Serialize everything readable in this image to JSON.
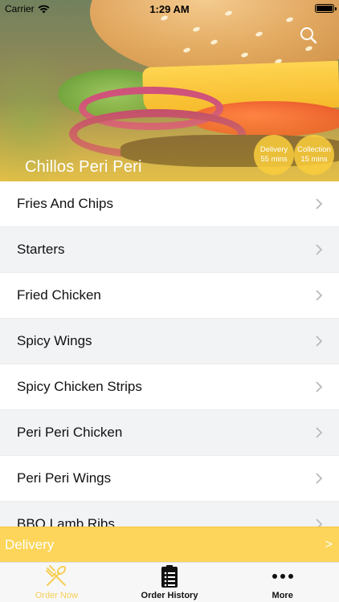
{
  "status_bar": {
    "carrier": "Carrier",
    "time": "1:29 AM"
  },
  "hero": {
    "restaurant_name": "Chillos Peri Peri",
    "delivery_badge": {
      "label": "Delivery",
      "time": "55 mins"
    },
    "collection_badge": {
      "label": "Collection",
      "time": "15 mins"
    },
    "search_icon": "search-icon"
  },
  "menu": {
    "items": [
      {
        "label": "Fries And Chips"
      },
      {
        "label": "Starters"
      },
      {
        "label": "Fried Chicken"
      },
      {
        "label": "Spicy Wings"
      },
      {
        "label": "Spicy Chicken Strips"
      },
      {
        "label": "Peri Peri Chicken"
      },
      {
        "label": "Peri Peri Wings"
      },
      {
        "label": "BBQ Lamb Ribs"
      }
    ]
  },
  "delivery_bar": {
    "label": "Delivery",
    "arrow": ">"
  },
  "tabs": [
    {
      "label": "Order Now",
      "icon": "fork-spoon-icon",
      "active": true
    },
    {
      "label": "Order History",
      "icon": "clipboard-list-icon",
      "active": false
    },
    {
      "label": "More",
      "icon": "more-dots-icon",
      "active": false
    }
  ],
  "colors": {
    "accent": "#fcd55a",
    "tab_active": "#f7cf56",
    "row_alt": "#f2f3f5"
  }
}
